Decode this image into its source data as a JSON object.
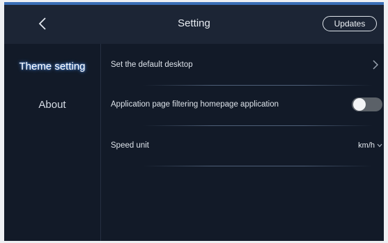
{
  "header": {
    "title": "Setting",
    "updates_label": "Updates",
    "back_icon": "chevron-left-icon"
  },
  "sidebar": {
    "items": [
      {
        "label": "Theme setting",
        "active": true
      },
      {
        "label": "About",
        "active": false
      }
    ]
  },
  "settings": {
    "rows": [
      {
        "label": "Set the default desktop",
        "control": "chevron-right-icon"
      },
      {
        "label": "Application page filtering homepage application",
        "control": "toggle",
        "toggle_on": false
      },
      {
        "label": "Speed unit",
        "control": "select",
        "value": "km/h",
        "icon": "chevron-down-icon"
      }
    ]
  },
  "colors": {
    "background": "#121a28",
    "header": "#1c2535",
    "accent": "#3a6fb6",
    "active_glow": "#4a8de8"
  }
}
